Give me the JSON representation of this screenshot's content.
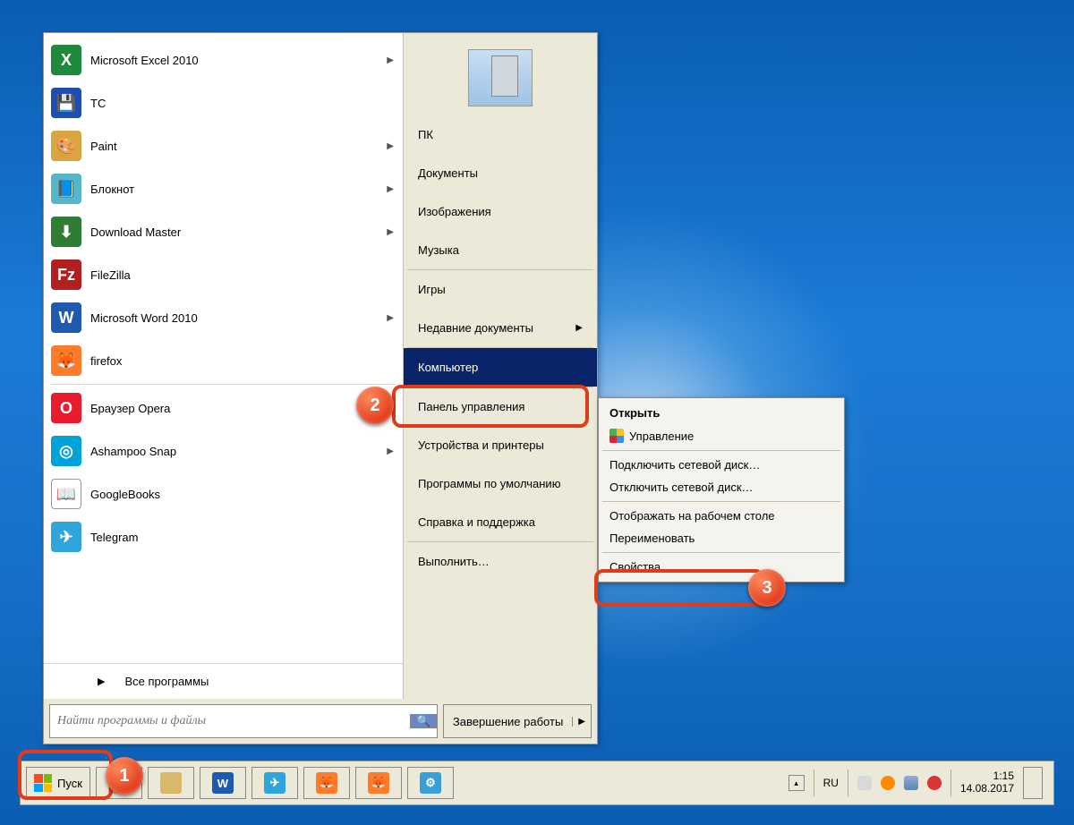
{
  "programs": [
    {
      "label": "Microsoft Excel 2010",
      "submenu": true,
      "color": "#1f8a3b",
      "glyph": "X"
    },
    {
      "label": "TC",
      "submenu": false,
      "color": "#1e4fb0",
      "glyph": "💾"
    },
    {
      "label": "Paint",
      "submenu": true,
      "color": "#d9a441",
      "glyph": "🎨"
    },
    {
      "label": "Блокнот",
      "submenu": true,
      "color": "#56b5c9",
      "glyph": "📘"
    },
    {
      "label": "Download Master",
      "submenu": true,
      "color": "#2e7d32",
      "glyph": "⬇"
    },
    {
      "label": "FileZilla",
      "submenu": false,
      "color": "#b02020",
      "glyph": "Fz"
    },
    {
      "label": "Microsoft Word 2010",
      "submenu": true,
      "color": "#1e5bb0",
      "glyph": "W"
    },
    {
      "label": "firefox",
      "submenu": false,
      "color": "#ff7b29",
      "glyph": "🦊"
    },
    {
      "label": "Браузер Opera",
      "submenu": true,
      "color": "#e81c2e",
      "glyph": "O",
      "sep_before": true
    },
    {
      "label": "Ashampoo Snap",
      "submenu": true,
      "color": "#00a3d9",
      "glyph": "◎"
    },
    {
      "label": "GoogleBooks",
      "submenu": false,
      "color": "#ffffff",
      "glyph": "📖"
    },
    {
      "label": "Telegram",
      "submenu": false,
      "color": "#2fa5db",
      "glyph": "✈"
    }
  ],
  "all_programs": "Все программы",
  "search": {
    "placeholder": "Найти программы и файлы"
  },
  "shutdown": {
    "label": "Завершение работы"
  },
  "right_items": [
    {
      "label": "ПК"
    },
    {
      "label": "Документы"
    },
    {
      "label": "Изображения"
    },
    {
      "label": "Музыка"
    },
    {
      "sep": true
    },
    {
      "label": "Игры"
    },
    {
      "label": "Недавние документы",
      "submenu": true
    },
    {
      "sep": true
    },
    {
      "label": "Компьютер",
      "highlight": true
    },
    {
      "sep": true
    },
    {
      "label": "Панель управления"
    },
    {
      "label": "Устройства и принтеры"
    },
    {
      "label": "Программы по умолчанию"
    },
    {
      "label": "Справка и поддержка"
    },
    {
      "sep": true
    },
    {
      "label": "Выполнить…"
    }
  ],
  "context": [
    {
      "label": "Открыть",
      "bold": true
    },
    {
      "label": "Управление",
      "shield": true
    },
    {
      "sep": true
    },
    {
      "label": "Подключить сетевой диск…"
    },
    {
      "label": "Отключить сетевой диск…"
    },
    {
      "sep": true
    },
    {
      "label": "Отображать на рабочем столе"
    },
    {
      "label": "Переименовать"
    },
    {
      "sep": true
    },
    {
      "label": "Свойства"
    }
  ],
  "taskbar": {
    "start": "Пуск",
    "lang": "RU",
    "clock": {
      "time": "1:15",
      "date": "14.08.2017"
    },
    "apps": [
      {
        "name": "explorer",
        "color": "#d9b86b"
      },
      {
        "name": "word",
        "color": "#1e5bb0",
        "glyph": "W"
      },
      {
        "name": "telegram",
        "color": "#2fa5db",
        "glyph": "✈"
      },
      {
        "name": "firefox1",
        "color": "#ff7b29",
        "glyph": "🦊"
      },
      {
        "name": "firefox2",
        "color": "#ff7b29",
        "glyph": "🦊"
      },
      {
        "name": "settings",
        "color": "#39a0d7",
        "glyph": "⚙"
      }
    ]
  },
  "markers": {
    "1": "1",
    "2": "2",
    "3": "3"
  }
}
